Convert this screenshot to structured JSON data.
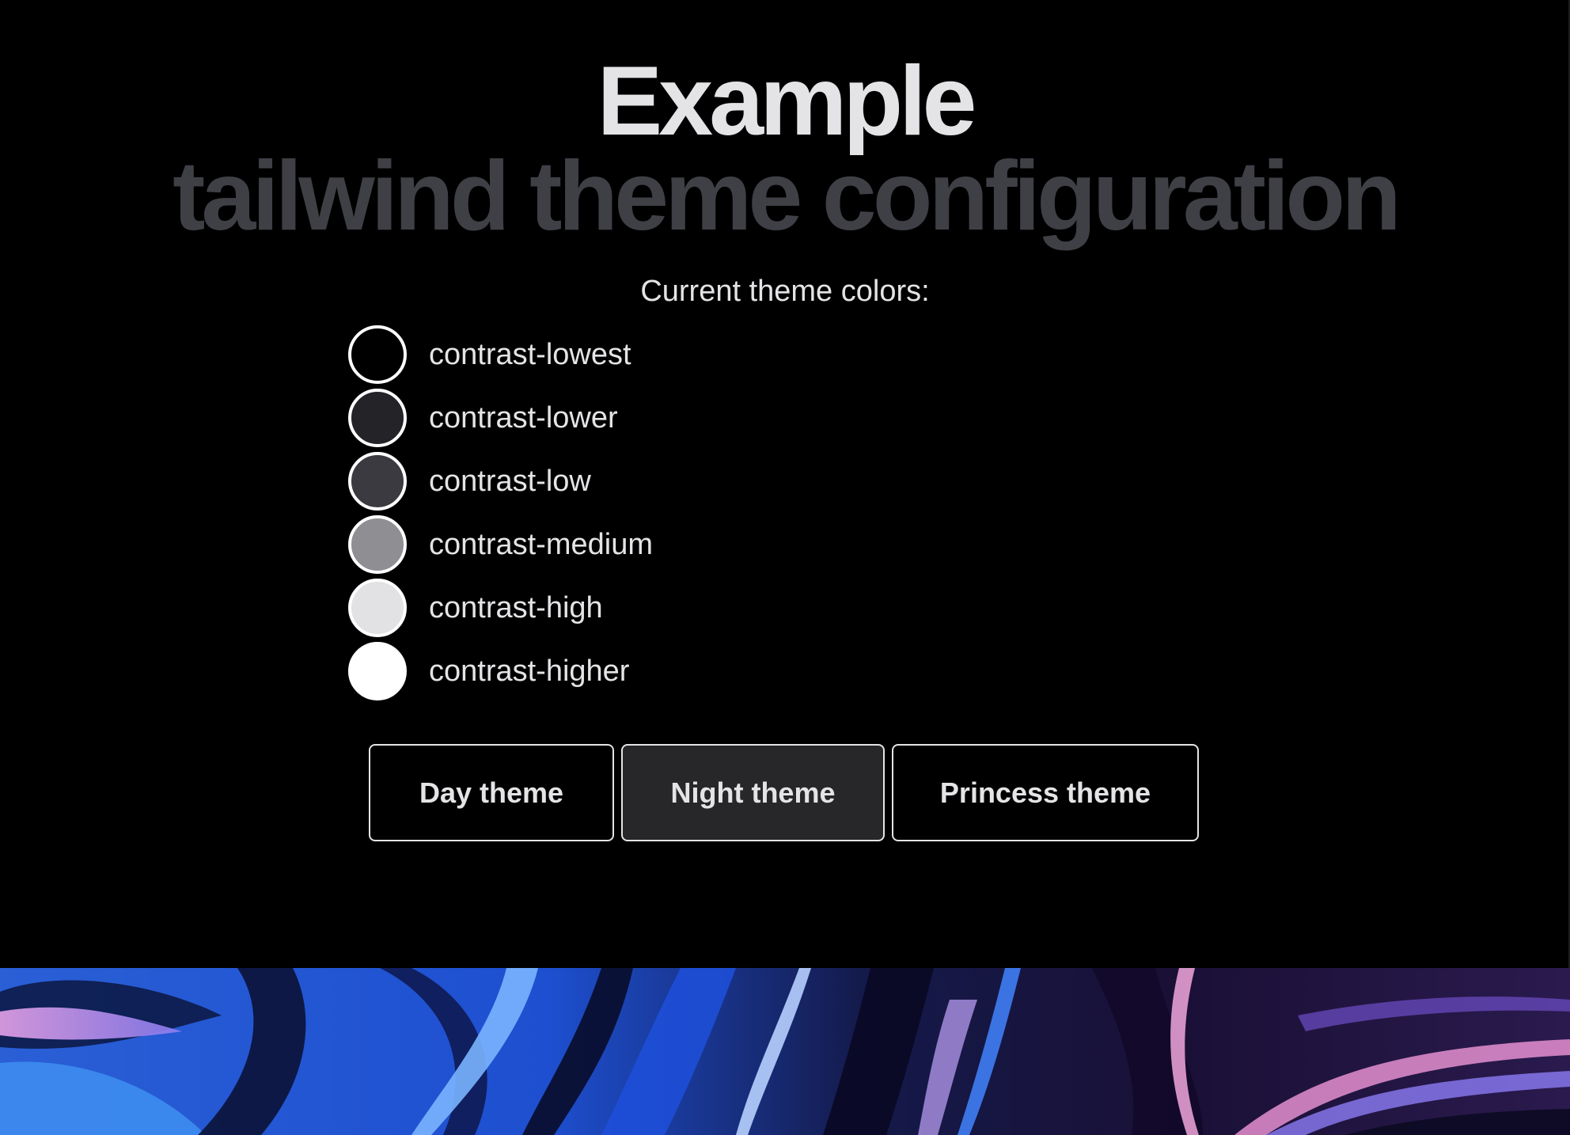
{
  "header": {
    "title": "Example",
    "subtitle": "tailwind theme configuration"
  },
  "colors_section": {
    "label": "Current theme colors:",
    "swatches": [
      {
        "name": "contrast-lowest",
        "color": "#000000"
      },
      {
        "name": "contrast-lower",
        "color": "#232328"
      },
      {
        "name": "contrast-low",
        "color": "#3a3a40"
      },
      {
        "name": "contrast-medium",
        "color": "#8e8e93"
      },
      {
        "name": "contrast-high",
        "color": "#e2e2e5"
      },
      {
        "name": "contrast-higher",
        "color": "#ffffff"
      }
    ]
  },
  "theme_buttons": {
    "day": "Day theme",
    "night": "Night theme",
    "princess": "Princess theme",
    "active": "night"
  },
  "palette": {
    "background": "#000000",
    "text_primary": "#e4e4e7",
    "text_muted": "#3f3f46",
    "active_button_bg": "#27272a"
  }
}
